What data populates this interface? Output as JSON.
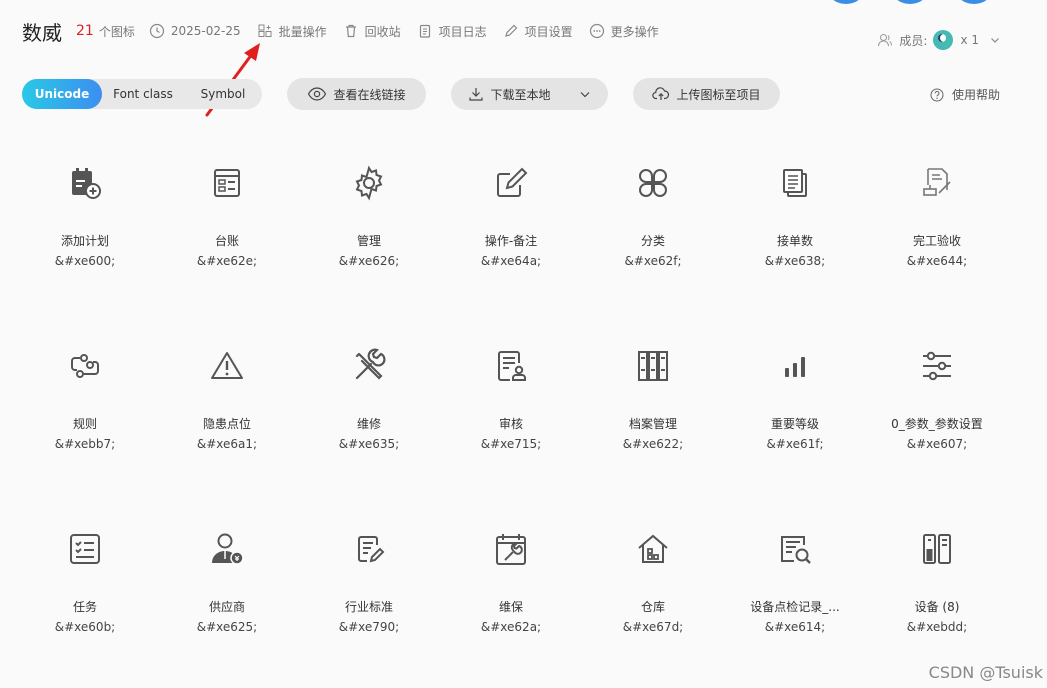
{
  "header": {
    "project_name": "数威",
    "icon_count": "21",
    "icon_count_label": "个图标",
    "date": "2025-02-25",
    "batch_ops": "批量操作",
    "recycle_bin": "回收站",
    "project_log": "项目日志",
    "project_settings": "项目设置",
    "more_ops": "更多操作",
    "members_label": "成员:",
    "members_count": "x 1"
  },
  "toolbar": {
    "tabs": [
      "Unicode",
      "Font class",
      "Symbol"
    ],
    "active_tab": "Unicode",
    "view_link": "查看在线链接",
    "download": "下载至本地",
    "upload": "上传图标至项目",
    "help": "使用帮助"
  },
  "icons": [
    {
      "name": "添加计划",
      "code": "&#xe600;",
      "icon": "calendar-add-icon"
    },
    {
      "name": "台账",
      "code": "&#xe62e;",
      "icon": "ledger-icon"
    },
    {
      "name": "管理",
      "code": "&#xe626;",
      "icon": "gear-icon"
    },
    {
      "name": "操作-备注",
      "code": "&#xe64a;",
      "icon": "edit-note-icon"
    },
    {
      "name": "分类",
      "code": "&#xe62f;",
      "icon": "category-icon"
    },
    {
      "name": "接单数",
      "code": "&#xe638;",
      "icon": "orders-icon"
    },
    {
      "name": "完工验收",
      "code": "&#xe644;",
      "icon": "acceptance-icon"
    },
    {
      "name": "规则",
      "code": "&#xebb7;",
      "icon": "rule-icon"
    },
    {
      "name": "隐患点位",
      "code": "&#xe6a1;",
      "icon": "warning-icon"
    },
    {
      "name": "维修",
      "code": "&#xe635;",
      "icon": "tools-icon"
    },
    {
      "name": "审核",
      "code": "&#xe715;",
      "icon": "audit-icon"
    },
    {
      "name": "档案管理",
      "code": "&#xe622;",
      "icon": "archive-icon"
    },
    {
      "name": "重要等级",
      "code": "&#xe61f;",
      "icon": "signal-bars-icon"
    },
    {
      "name": "0_参数_参数设置",
      "code": "&#xe607;",
      "icon": "sliders-icon"
    },
    {
      "name": "任务",
      "code": "&#xe60b;",
      "icon": "task-list-icon"
    },
    {
      "name": "供应商",
      "code": "&#xe625;",
      "icon": "supplier-icon"
    },
    {
      "name": "行业标准",
      "code": "&#xe790;",
      "icon": "standard-doc-icon"
    },
    {
      "name": "维保",
      "code": "&#xe62a;",
      "icon": "maintenance-icon"
    },
    {
      "name": "仓库",
      "code": "&#xe67d;",
      "icon": "warehouse-icon"
    },
    {
      "name": "设备点检记录_...",
      "code": "&#xe614;",
      "icon": "inspection-record-icon"
    },
    {
      "name": "设备 (8)",
      "code": "&#xebdd;",
      "icon": "device-icon"
    }
  ],
  "watermark": "CSDN @Tsuisk",
  "colors": {
    "accent_start": "#29c9e6",
    "accent_end": "#3c8ef0",
    "count_red": "#e02020",
    "arrow_red": "#e0201e"
  }
}
